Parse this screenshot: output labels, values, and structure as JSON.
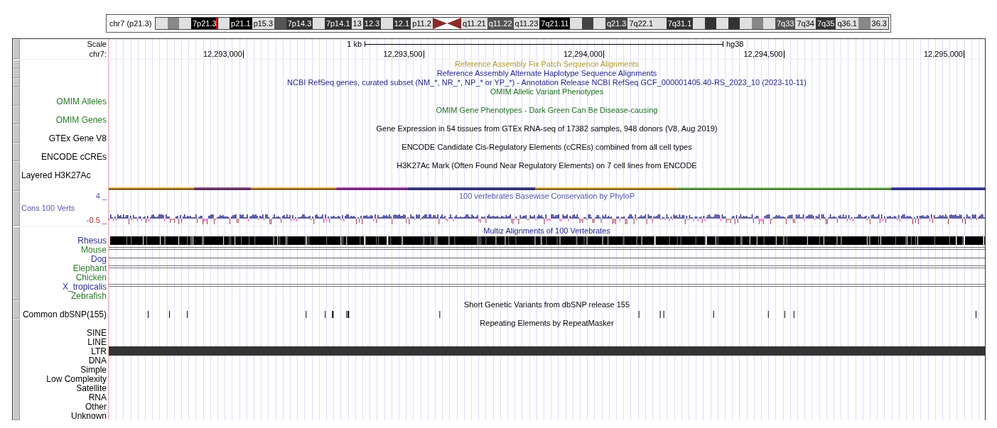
{
  "ideogram": {
    "label": "chr7 (p21.3)",
    "bands": [
      {
        "kind": "band",
        "color": "#e0e0e0"
      },
      {
        "kind": "band",
        "color": "#888888"
      },
      {
        "kind": "band",
        "color": "#e0e0e0"
      },
      {
        "kind": "band",
        "label": "7p21.3",
        "color": "#000000",
        "current": true
      },
      {
        "kind": "band",
        "color": "#e0e0e0"
      },
      {
        "kind": "band",
        "label": "p21.1",
        "color": "#000000"
      },
      {
        "kind": "band",
        "label": "p15.3",
        "color": "#e0e0e0"
      },
      {
        "kind": "band",
        "color": "#555555"
      },
      {
        "kind": "band",
        "label": "7p14.3",
        "color": "#333333"
      },
      {
        "kind": "band",
        "color": "#e0e0e0"
      },
      {
        "kind": "band",
        "label": "7p14.1",
        "color": "#333333"
      },
      {
        "kind": "band",
        "label": "13",
        "color": "#e0e0e0"
      },
      {
        "kind": "band",
        "label": "12.3",
        "color": "#333333"
      },
      {
        "kind": "band",
        "color": "#e0e0e0"
      },
      {
        "kind": "band",
        "label": "12.1",
        "color": "#333333"
      },
      {
        "kind": "band",
        "label": "p11.2",
        "color": "#e0e0e0"
      },
      {
        "kind": "centromere",
        "color": "#8b2b2b"
      },
      {
        "kind": "band",
        "label": "q11.21",
        "color": "#e0e0e0"
      },
      {
        "kind": "band",
        "label": "q11.22",
        "color": "#555555"
      },
      {
        "kind": "band",
        "label": "q11.23",
        "color": "#e0e0e0"
      },
      {
        "kind": "band",
        "label": "7q21.11",
        "color": "#000000"
      },
      {
        "kind": "band",
        "color": "#e0e0e0"
      },
      {
        "kind": "band",
        "color": "#444444"
      },
      {
        "kind": "band",
        "color": "#e0e0e0"
      },
      {
        "kind": "band",
        "label": "q21.3",
        "color": "#444444"
      },
      {
        "kind": "band",
        "label": "7q22.1",
        "color": "#e0e0e0"
      },
      {
        "kind": "band",
        "color": "#e0e0e0"
      },
      {
        "kind": "band",
        "label": "7q31.1",
        "color": "#333333"
      },
      {
        "kind": "band",
        "color": "#e0e0e0"
      },
      {
        "kind": "band",
        "color": "#333333"
      },
      {
        "kind": "band",
        "color": "#e0e0e0"
      },
      {
        "kind": "band",
        "color": "#333333"
      },
      {
        "kind": "band",
        "color": "#e0e0e0"
      },
      {
        "kind": "band",
        "color": "#888888"
      },
      {
        "kind": "band",
        "color": "#e0e0e0"
      },
      {
        "kind": "band",
        "label": "7q33",
        "color": "#555555"
      },
      {
        "kind": "band",
        "label": "7q34",
        "color": "#e0e0e0"
      },
      {
        "kind": "band",
        "label": "7q35",
        "color": "#333333"
      },
      {
        "kind": "band",
        "label": "q36.1",
        "color": "#e0e0e0"
      },
      {
        "kind": "band",
        "color": "#888888"
      },
      {
        "kind": "band",
        "label": "36.3",
        "color": "#e0e0e0"
      }
    ]
  },
  "tracks": [
    {
      "kind": "ruler",
      "scale_label": "Scale",
      "span": "1 kb",
      "assembly": "hg38",
      "chrom_label": "chr7:",
      "positions": [
        "12,293,000",
        "12,293,500",
        "12,294,000",
        "12,294,500",
        "12,295,000"
      ]
    },
    {
      "kind": "rows",
      "rows": [
        {
          "kind": "plain",
          "title": "Reference Assembly Fix Patch Sequence Alignments",
          "color": "#b09a30"
        }
      ]
    },
    {
      "kind": "rows",
      "rows": [
        {
          "kind": "plain",
          "title": "Reference Assembly Alternate Haplotype Sequence Alignments",
          "color": "#1f1f8f"
        }
      ]
    },
    {
      "kind": "rows",
      "rows": [
        {
          "kind": "plain",
          "title": "NCBI RefSeq genes, curated subset (NM_*, NR_*, NP_* or YP_*) - Annotation Release NCBI RefSeq GCF_000001405.40-RS_2023_10 (2023-10-11)",
          "color": "#1f1f8f"
        }
      ]
    },
    {
      "kind": "rows",
      "rows": [
        {
          "kind": "plain",
          "title": "OMIM Allelic Variant Phenotypes",
          "color": "#1f6f1f"
        },
        {
          "kind": "plain",
          "label": "OMIM Alleles",
          "color": "#2a7a2a"
        }
      ]
    },
    {
      "kind": "rows",
      "rows": [
        {
          "kind": "plain",
          "title": "OMIM Gene Phenotypes - Dark Green Can Be Disease-causing",
          "color": "#1f6f1f"
        },
        {
          "kind": "plain",
          "label": "OMIM Genes",
          "color": "#2a7a2a"
        }
      ]
    },
    {
      "kind": "rows",
      "rows": [
        {
          "kind": "plain",
          "title": "Gene Expression in 54 tissues from GTEx RNA-seq of 17382 samples, 948 donors (V8, Aug 2019)",
          "color": "#000000"
        },
        {
          "kind": "plain",
          "label": "GTEx Gene V8",
          "color": "#000000"
        }
      ]
    },
    {
      "kind": "rows",
      "rows": [
        {
          "kind": "plain",
          "title": "ENCODE Candidate Cis-Regulatory Elements (cCREs) combined from all cell types",
          "color": "#000000"
        },
        {
          "kind": "plain",
          "label": "ENCODE cCREs",
          "color": "#000000"
        }
      ]
    },
    {
      "kind": "rows",
      "rows": [
        {
          "kind": "plain",
          "title": "H3K27Ac Mark (Often Found Near Regulatory Elements) on 7 cell lines from ENCODE",
          "color": "#000000"
        },
        {
          "kind": "layered_label",
          "label": "Layered H3K27Ac",
          "color": "#000000"
        },
        {
          "kind": "layered"
        }
      ]
    },
    {
      "kind": "conservation",
      "max_label": "4 _",
      "title": "100 vertebrates Basewise Conservation by PhyloP",
      "label": "Cons 100 Verts",
      "min_label": "-0.5 _"
    },
    {
      "kind": "rows",
      "rows": [
        {
          "kind": "plain",
          "title": "Multiz Alignments of 100 Vertebrates",
          "color": "#1f1f8f"
        },
        {
          "kind": "alignment_bar",
          "label": "Rhesus",
          "color": "#2f2f8f"
        },
        {
          "kind": "double_line",
          "label": "Mouse",
          "color": "#2a7a2a"
        },
        {
          "kind": "single_line",
          "label": "Dog",
          "color": "#2f2f8f"
        },
        {
          "kind": "double_line",
          "label": "Elephant",
          "color": "#2a7a2a"
        },
        {
          "kind": "plain",
          "label": "Chicken",
          "color": "#2a7a2a"
        },
        {
          "kind": "double_line",
          "label": "X_tropicalis",
          "color": "#2f2f8f"
        },
        {
          "kind": "plain",
          "label": "Zebrafish",
          "color": "#2a7a2a"
        }
      ]
    },
    {
      "kind": "rows",
      "rows": [
        {
          "kind": "plain",
          "title": "Short Genetic Variants from dbSNP release 155",
          "color": "#000000"
        },
        {
          "kind": "snp",
          "label": "Common dbSNP(155)",
          "color": "#000000"
        }
      ]
    },
    {
      "kind": "rows",
      "rows": [
        {
          "kind": "plain",
          "title": "Repeating Elements by RepeatMasker",
          "color": "#000000"
        },
        {
          "kind": "plain",
          "label": "SINE",
          "color": "#000000"
        },
        {
          "kind": "plain",
          "label": "LINE",
          "color": "#000000"
        },
        {
          "kind": "repeat_bar",
          "label": "LTR",
          "color": "#000000"
        },
        {
          "kind": "plain",
          "label": "DNA",
          "color": "#000000"
        },
        {
          "kind": "plain",
          "label": "Simple",
          "color": "#000000"
        },
        {
          "kind": "plain",
          "label": "Low Complexity",
          "color": "#000000"
        },
        {
          "kind": "plain",
          "label": "Satellite",
          "color": "#000000"
        },
        {
          "kind": "plain",
          "label": "RNA",
          "color": "#000000"
        },
        {
          "kind": "plain",
          "label": "Other",
          "color": "#000000"
        },
        {
          "kind": "plain",
          "label": "Unknown",
          "color": "#000000"
        }
      ]
    }
  ]
}
